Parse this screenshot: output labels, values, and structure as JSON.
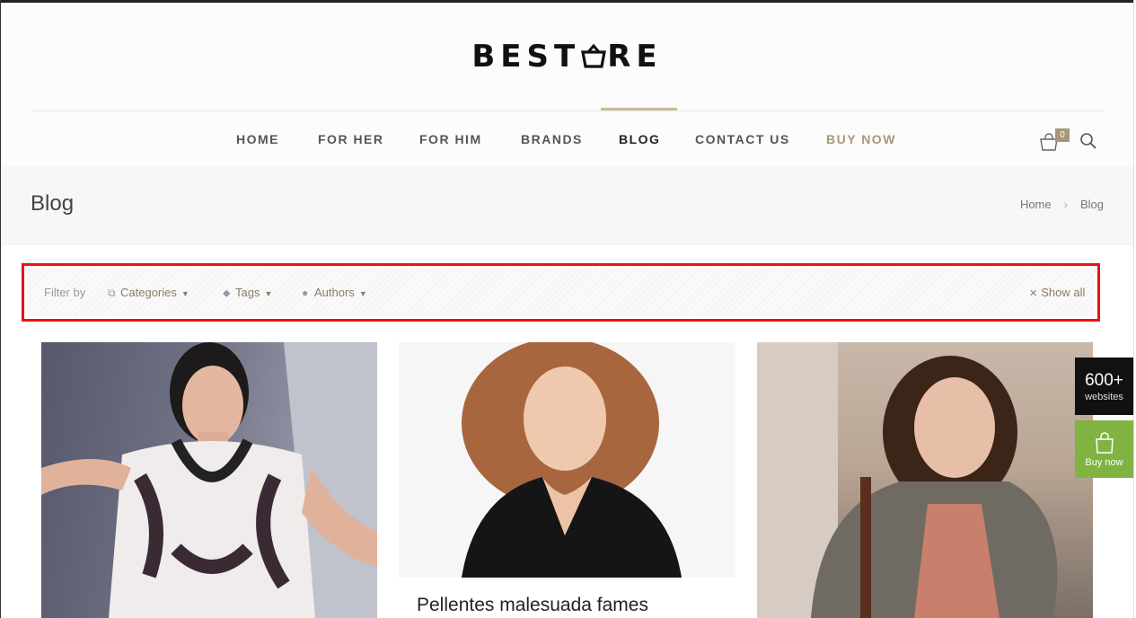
{
  "logo": {
    "text_before": "BEST",
    "text_after": "RE",
    "icon": "shopping-bag-icon"
  },
  "nav": {
    "items": [
      {
        "label": "HOME",
        "state": "normal"
      },
      {
        "label": "FOR HER",
        "state": "normal"
      },
      {
        "label": "FOR HIM",
        "state": "normal"
      },
      {
        "label": "BRANDS",
        "state": "normal"
      },
      {
        "label": "BLOG",
        "state": "active"
      },
      {
        "label": "CONTACT US",
        "state": "normal"
      },
      {
        "label": "BUY NOW",
        "state": "highlight"
      }
    ],
    "cart_count": "0",
    "icons": [
      "cart-icon",
      "search-icon"
    ]
  },
  "subheader": {
    "title": "Blog",
    "breadcrumb": [
      "Home",
      "Blog"
    ]
  },
  "filter": {
    "label": "Filter by",
    "categories": "Categories",
    "tags": "Tags",
    "authors": "Authors",
    "show_all": "Show all"
  },
  "posts": [
    {
      "image": "woman-in-patterned-dress-photo"
    },
    {
      "image": "woman-in-black-top-photo",
      "title": "Pellentes malesuada fames"
    },
    {
      "image": "woman-in-grey-cardigan-photo"
    }
  ],
  "widgets": {
    "websites_count": "600+",
    "websites_label": "websites",
    "buy_label": "Buy now"
  },
  "colors": {
    "accent": "#a9977a",
    "highlight_border": "#ee1111",
    "buy_widget": "#80b341"
  }
}
